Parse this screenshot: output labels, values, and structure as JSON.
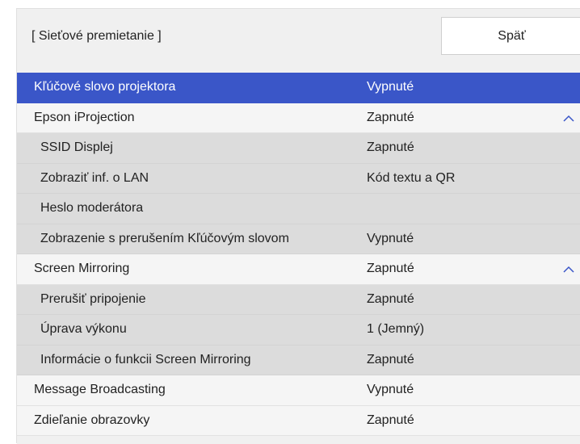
{
  "header": {
    "title": "[ Sieťové premietanie ]",
    "back_label": "Späť"
  },
  "rows": [
    {
      "label": "Kľúčové slovo projektora",
      "value": "Vypnuté",
      "kind": "top",
      "selected": true,
      "chevron": false
    },
    {
      "label": "Epson iProjection",
      "value": "Zapnuté",
      "kind": "top",
      "selected": false,
      "chevron": true,
      "chevron_icon": "chevron-up-icon"
    },
    {
      "label": "SSID Displej",
      "value": "Zapnuté",
      "kind": "sub",
      "selected": false,
      "chevron": false
    },
    {
      "label": "Zobraziť inf. o LAN",
      "value": "Kód textu a QR",
      "kind": "sub",
      "selected": false,
      "chevron": false
    },
    {
      "label": "Heslo moderátora",
      "value": "",
      "kind": "sub",
      "selected": false,
      "chevron": false
    },
    {
      "label": "Zobrazenie s prerušením Kľúčovým slovom",
      "value": "Vypnuté",
      "kind": "sub",
      "selected": false,
      "chevron": false
    },
    {
      "label": "Screen Mirroring",
      "value": "Zapnuté",
      "kind": "top",
      "selected": false,
      "chevron": true,
      "chevron_icon": "chevron-up-icon"
    },
    {
      "label": "Prerušiť pripojenie",
      "value": "Zapnuté",
      "kind": "sub",
      "selected": false,
      "chevron": false
    },
    {
      "label": "Úprava výkonu",
      "value": "1 (Jemný)",
      "kind": "sub",
      "selected": false,
      "chevron": false
    },
    {
      "label": "Informácie o funkcii Screen Mirroring",
      "value": "Zapnuté",
      "kind": "sub",
      "selected": false,
      "chevron": false
    },
    {
      "label": "Message Broadcasting",
      "value": "Vypnuté",
      "kind": "top",
      "selected": false,
      "chevron": false
    },
    {
      "label": "Zdieľanie obrazovky",
      "value": "Zapnuté",
      "kind": "top",
      "selected": false,
      "chevron": false
    }
  ],
  "colors": {
    "selection": "#3a56c8",
    "sub_background": "#dcdcdc",
    "top_background": "#f5f5f5",
    "panel_background": "#f0f0f0"
  }
}
